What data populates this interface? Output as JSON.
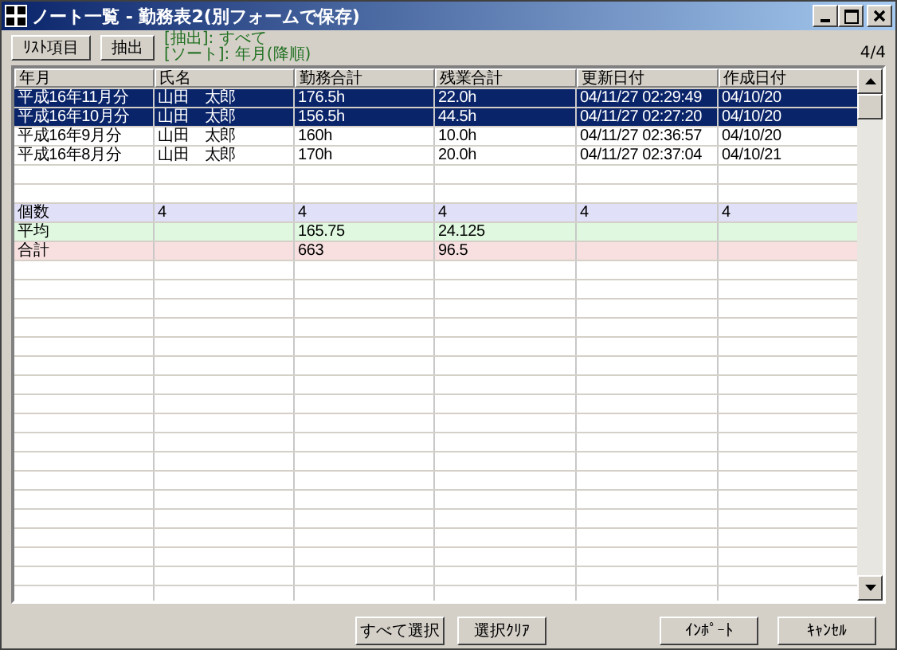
{
  "window": {
    "title": "ノート一覧 - 勤務表2(別フォームで保存)"
  },
  "toolbar": {
    "buttons": [
      "ﾘｽﾄ項目",
      "抽出"
    ],
    "filter": "[抽出]: すべて",
    "sort": "[ソート]: 年月(降順)",
    "count": "4/4"
  },
  "table": {
    "columns": [
      "年月",
      "氏名",
      "勤務合計",
      "残業合計",
      "更新日付",
      "作成日付"
    ],
    "rows": [
      {
        "cells": [
          "平成16年11月分",
          "山田　太郎",
          "176.5h",
          "22.0h",
          "04/11/27 02:29:49",
          "04/10/20"
        ],
        "selected": true
      },
      {
        "cells": [
          "平成16年10月分",
          "山田　太郎",
          "156.5h",
          "44.5h",
          "04/11/27 02:27:20",
          "04/10/20"
        ],
        "selected": true
      },
      {
        "cells": [
          "平成16年9月分",
          "山田　太郎",
          "160h",
          "10.0h",
          "04/11/27 02:36:57",
          "04/10/20"
        ],
        "selected": false
      },
      {
        "cells": [
          "平成16年8月分",
          "山田　太郎",
          "170h",
          "20.0h",
          "04/11/27 02:37:04",
          "04/10/21"
        ],
        "selected": false
      }
    ],
    "summary_rows": [
      {
        "label": "個数",
        "cells": [
          "4",
          "4",
          "4",
          "4",
          "4"
        ],
        "color": "#e0e0f8"
      },
      {
        "label": "平均",
        "cells": [
          "",
          "165.75",
          "24.125",
          "",
          ""
        ],
        "color": "#e0f8e0"
      },
      {
        "label": "合計",
        "cells": [
          "",
          "663",
          "96.5",
          "",
          ""
        ],
        "color": "#f8e0e0"
      }
    ]
  },
  "footer": {
    "buttons_left": [
      "すべて選択",
      "選択ｸﾘｱ"
    ],
    "buttons_right": [
      "ｲﾝﾎﾟｰﾄ",
      "ｷｬﾝｾﾙ"
    ]
  }
}
